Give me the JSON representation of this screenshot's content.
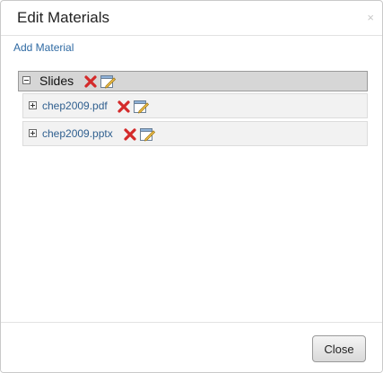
{
  "dialog": {
    "title": "Edit Materials",
    "close_glyph": "×",
    "add_material_label": "Add Material"
  },
  "tree": {
    "folder": {
      "label": "Slides",
      "expanded": true,
      "actions": [
        "delete-icon",
        "edit-icon"
      ]
    },
    "files": [
      {
        "label": "chep2009.pdf",
        "actions": [
          "delete-icon",
          "edit-icon"
        ]
      },
      {
        "label": "chep2009.pptx",
        "actions": [
          "delete-icon",
          "edit-icon"
        ]
      }
    ]
  },
  "footer": {
    "close_label": "Close"
  },
  "colors": {
    "link": "#2f6aa3",
    "delete_icon": "#d42a2a",
    "folder_row_bg": "#d6d6d6",
    "file_row_bg": "#f2f2f2"
  }
}
